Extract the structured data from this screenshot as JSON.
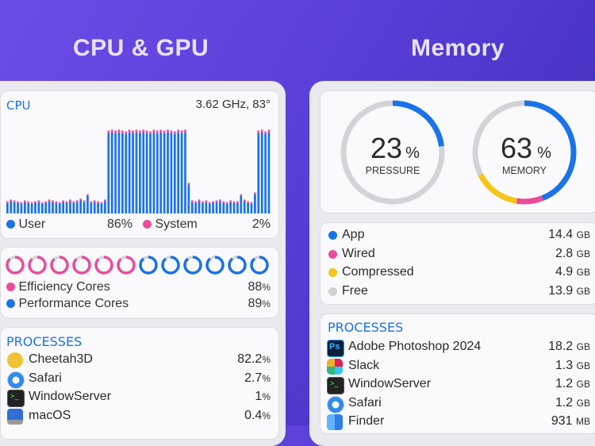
{
  "headings": {
    "cpu_gpu": "CPU & GPU",
    "memory": "Memory"
  },
  "colors": {
    "user": "#1a73e8",
    "system": "#ea4c9a",
    "app": "#1a73e8",
    "wired": "#ea4c9a",
    "compressed": "#f5c518",
    "free": "#d0d0d0"
  },
  "cpu": {
    "title": "CPU",
    "freq_temp": "3.62 GHz, 83°",
    "legend": {
      "user_label": "User",
      "user_value": "86%",
      "system_label": "System",
      "system_value": "2%"
    },
    "history_user": [
      0.12,
      0.14,
      0.13,
      0.12,
      0.11,
      0.13,
      0.12,
      0.11,
      0.12,
      0.13,
      0.11,
      0.12,
      0.14,
      0.13,
      0.12,
      0.11,
      0.13,
      0.12,
      0.14,
      0.12,
      0.13,
      0.15,
      0.13,
      0.2,
      0.12,
      0.13,
      0.12,
      0.11,
      0.14,
      0.92,
      0.93,
      0.92,
      0.93,
      0.92,
      0.91,
      0.93,
      0.92,
      0.93,
      0.92,
      0.93,
      0.92,
      0.91,
      0.93,
      0.92,
      0.93,
      0.92,
      0.93,
      0.92,
      0.91,
      0.93,
      0.92,
      0.93,
      0.33,
      0.13,
      0.12,
      0.14,
      0.12,
      0.13,
      0.11,
      0.12,
      0.13,
      0.14,
      0.12,
      0.11,
      0.13,
      0.12,
      0.12,
      0.2,
      0.14,
      0.12,
      0.11,
      0.22,
      0.92,
      0.93,
      0.91,
      0.93
    ],
    "history_system": [
      0.02,
      0.02,
      0.02,
      0.02,
      0.02,
      0.02,
      0.02,
      0.02,
      0.02,
      0.02,
      0.02,
      0.02,
      0.02,
      0.02,
      0.02,
      0.02,
      0.02,
      0.02,
      0.02,
      0.02,
      0.02,
      0.02,
      0.02,
      0.02,
      0.02,
      0.02,
      0.02,
      0.02,
      0.02,
      0.03,
      0.03,
      0.03,
      0.03,
      0.03,
      0.03,
      0.03,
      0.03,
      0.03,
      0.03,
      0.03,
      0.03,
      0.03,
      0.03,
      0.03,
      0.03,
      0.03,
      0.03,
      0.03,
      0.03,
      0.03,
      0.03,
      0.03,
      0.02,
      0.02,
      0.02,
      0.02,
      0.02,
      0.02,
      0.02,
      0.02,
      0.02,
      0.02,
      0.02,
      0.02,
      0.02,
      0.02,
      0.02,
      0.02,
      0.02,
      0.02,
      0.02,
      0.02,
      0.03,
      0.03,
      0.03,
      0.03
    ]
  },
  "cores": {
    "efficiency": {
      "label": "Efficiency Cores",
      "value": "88",
      "unit": "%",
      "count": 6
    },
    "performance": {
      "label": "Performance Cores",
      "value": "89",
      "unit": "%",
      "count": 6
    },
    "efficiency_loads": [
      0.88,
      0.88,
      0.88,
      0.88,
      0.88,
      0.88
    ],
    "performance_loads": [
      0.89,
      0.89,
      0.89,
      0.89,
      0.89,
      0.89
    ]
  },
  "processes_left": {
    "title": "PROCESSES",
    "items": [
      {
        "name": "Cheetah3D",
        "value": "82.2",
        "unit": "%",
        "icon": "cheetah-icon"
      },
      {
        "name": "Safari",
        "value": "2.7",
        "unit": "%",
        "icon": "safari-icon"
      },
      {
        "name": "WindowServer",
        "value": "1",
        "unit": "%",
        "icon": "terminal-icon"
      },
      {
        "name": "macOS",
        "value": "0.4",
        "unit": "%",
        "icon": "laptop-icon"
      }
    ]
  },
  "memory": {
    "pressure": {
      "value": "23",
      "unit": "%",
      "label": "PRESSURE",
      "fraction": 0.23
    },
    "memory": {
      "value": "63",
      "unit": "%",
      "label": "MEMORY",
      "segments": [
        0.44,
        0.085,
        0.15
      ]
    },
    "legend": [
      {
        "label": "App",
        "value": "14.4",
        "unit": "GB",
        "color": "#1a73e8"
      },
      {
        "label": "Wired",
        "value": "2.8",
        "unit": "GB",
        "color": "#ea4c9a"
      },
      {
        "label": "Compressed",
        "value": "4.9",
        "unit": "GB",
        "color": "#f5c518"
      },
      {
        "label": "Free",
        "value": "13.9",
        "unit": "GB",
        "color": "#d0d0d0"
      }
    ]
  },
  "processes_right": {
    "title": "PROCESSES",
    "items": [
      {
        "name": "Adobe Photoshop 2024",
        "value": "18.2",
        "unit": "GB",
        "icon": "photoshop-icon"
      },
      {
        "name": "Slack",
        "value": "1.3",
        "unit": "GB",
        "icon": "slack-icon"
      },
      {
        "name": "WindowServer",
        "value": "1.2",
        "unit": "GB",
        "icon": "terminal-icon"
      },
      {
        "name": "Safari",
        "value": "1.2",
        "unit": "GB",
        "icon": "safari-icon"
      },
      {
        "name": "Finder",
        "value": "931",
        "unit": "MB",
        "icon": "finder-icon"
      }
    ]
  }
}
